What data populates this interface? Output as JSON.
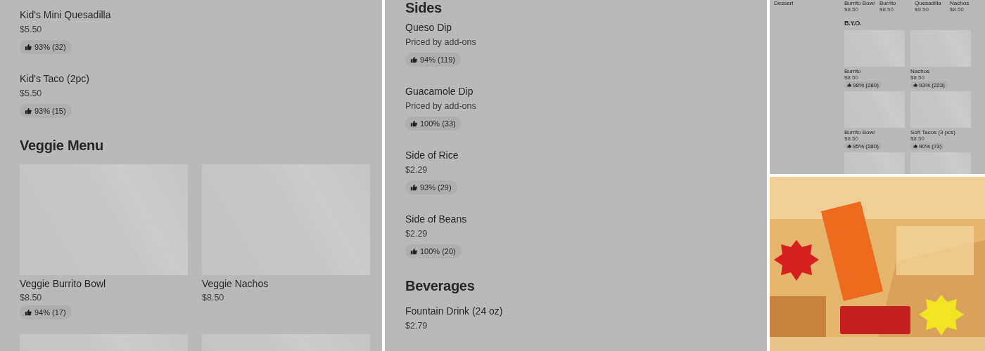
{
  "left_panel": {
    "items": [
      {
        "name": "Kid's Mini Quesadilla",
        "price": "$5.50",
        "rating": "93% (32)"
      },
      {
        "name": "Kid's Taco (2pc)",
        "price": "$5.50",
        "rating": "93% (15)"
      }
    ],
    "section": {
      "title": "Veggie Menu",
      "cards": [
        {
          "name": "Veggie Burrito Bowl",
          "price": "$8.50",
          "rating": "94% (17)"
        },
        {
          "name": "Veggie Nachos",
          "price": "$8.50"
        }
      ]
    }
  },
  "middle_panel": {
    "sections": [
      {
        "title": "Sides",
        "items": [
          {
            "name": "Queso Dip",
            "price": "Priced by add-ons",
            "rating": "94% (119)"
          },
          {
            "name": "Guacamole Dip",
            "price": "Priced by add-ons",
            "rating": "100% (33)"
          },
          {
            "name": "Side of Rice",
            "price": "$2.29",
            "rating": "93% (29)"
          },
          {
            "name": "Side of Beans",
            "price": "$2.29",
            "rating": "100% (20)"
          }
        ]
      },
      {
        "title": "Beverages",
        "items": [
          {
            "name": "Fountain Drink (24 oz)",
            "price": "$2.79"
          }
        ]
      }
    ]
  },
  "right_top_panel": {
    "sidebar_item": "Dessert",
    "top_row": [
      {
        "name": "Burrito Bowl",
        "price": "$8.50"
      },
      {
        "name": "Burrito",
        "price": "$8.50"
      },
      {
        "name": "Quesadilla",
        "price": "$9.50"
      },
      {
        "name": "Nachos",
        "price": "$8.50"
      }
    ],
    "section": {
      "title": "B.Y.O.",
      "cards": [
        {
          "name": "Burrito",
          "price": "$8.50",
          "rating": "98% (280)"
        },
        {
          "name": "Nachos",
          "price": "$8.50",
          "rating": "93% (223)"
        },
        {
          "name": "Burrito Bowl",
          "price": "$8.50",
          "rating": "95% (280)"
        },
        {
          "name": "Soft Tacos (3 pcs)",
          "price": "$8.50",
          "rating": "90% (73)"
        }
      ]
    }
  }
}
